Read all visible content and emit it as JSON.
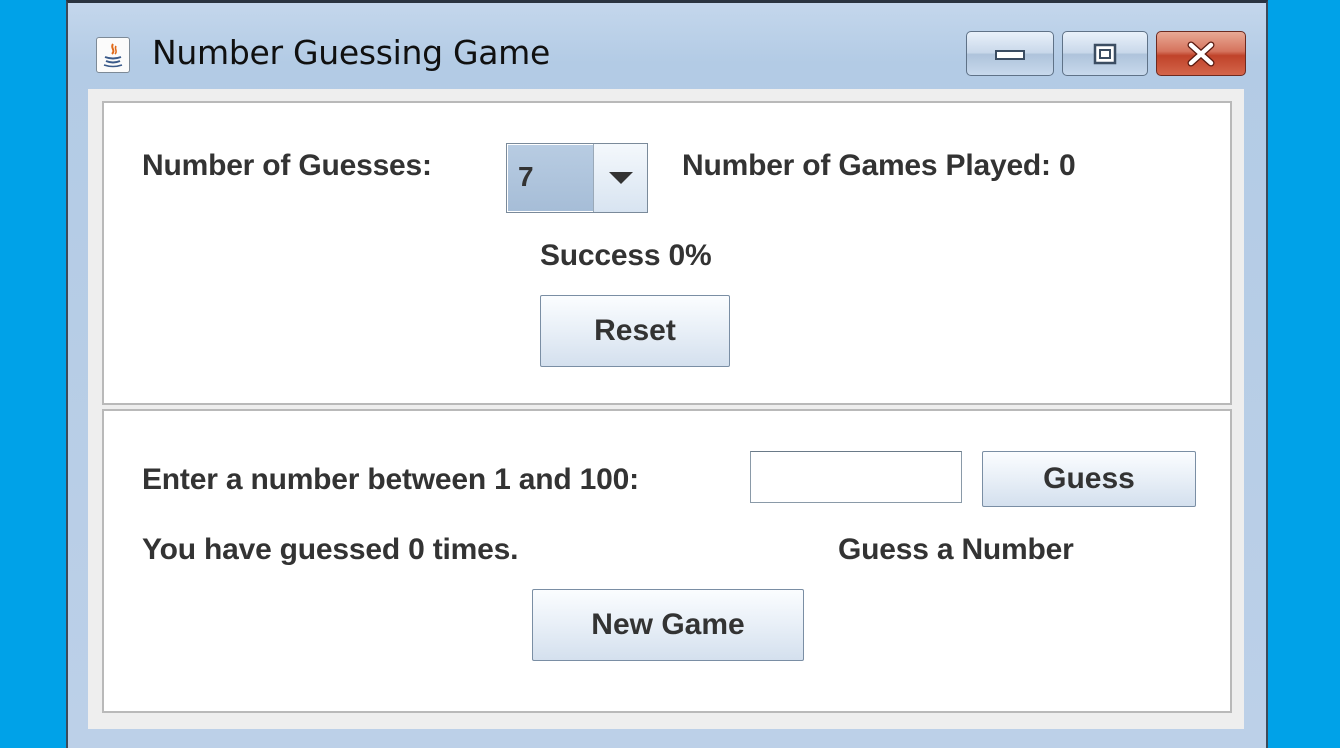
{
  "window": {
    "title": "Number Guessing Game",
    "controls": [
      "minimize",
      "maximize",
      "close"
    ]
  },
  "settings_panel": {
    "guesses_label": "Number of Guesses:",
    "guesses_value": "7",
    "games_played_label": "Number of Games Played: 0",
    "success_label": "Success 0%",
    "reset_label": "Reset"
  },
  "game_panel": {
    "prompt_label": "Enter a number between 1 and 100:",
    "guess_input_value": "",
    "guess_button_label": "Guess",
    "guess_count_label": "You have guessed 0 times.",
    "status_label": "Guess a Number",
    "new_game_label": "New Game"
  },
  "colors": {
    "desktop": "#00a2e8",
    "close_button": "#c0432a"
  },
  "icons": [
    "java-app-icon",
    "minimize-icon",
    "maximize-icon",
    "close-icon",
    "dropdown-arrow-icon"
  ]
}
